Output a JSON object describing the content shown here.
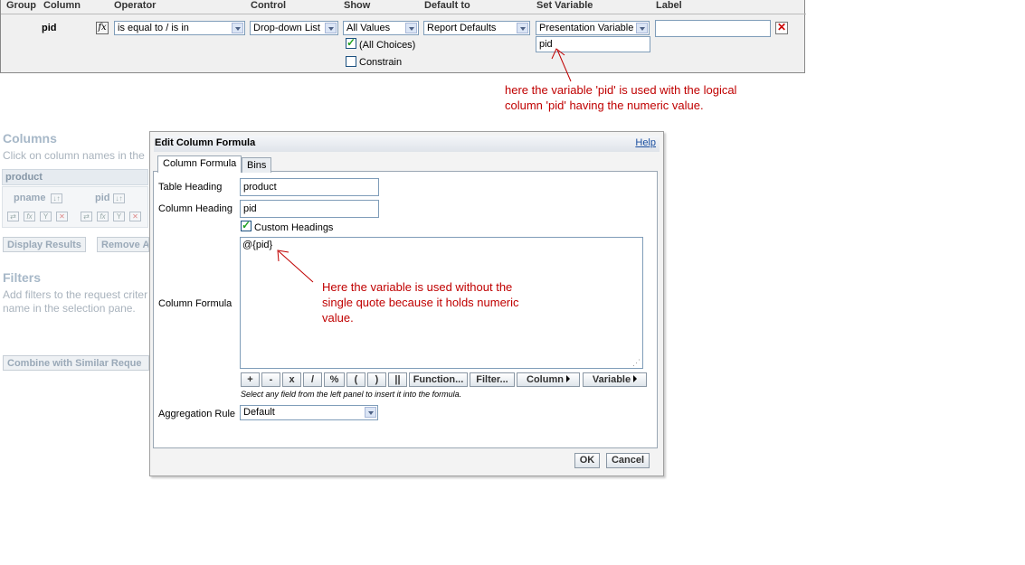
{
  "prompt_table": {
    "headers": {
      "group": "Group",
      "column": "Column",
      "operator": "Operator",
      "control": "Control",
      "show": "Show",
      "default_to": "Default to",
      "set_variable": "Set Variable",
      "label": "Label"
    },
    "row": {
      "column_name": "pid",
      "operator": "is equal to / is in",
      "control": "Drop-down List",
      "show": "All Values",
      "default_to": "Report Defaults",
      "set_variable": "Presentation Variable",
      "variable_name": "pid",
      "label_value": "",
      "all_choices_label": "(All Choices)",
      "constrain_label": "Constrain"
    }
  },
  "annotations": {
    "top_line1": "here the variable 'pid' is used with the logical",
    "top_line2": "column 'pid' having the numeric value.",
    "mid_line1": "Here the variable is used without the",
    "mid_line2": "single quote because it holds numeric",
    "mid_line3": "value."
  },
  "background": {
    "columns_heading": "Columns",
    "columns_hint": "Click on column names in the",
    "table_name": "product",
    "col1": "pname",
    "col2": "pid",
    "display_results": "Display Results",
    "remove_all": "Remove A",
    "filters_heading": "Filters",
    "filters_hint1": "Add filters to the request criter",
    "filters_hint2": "name in the selection pane.",
    "combine": "Combine with Similar Reque"
  },
  "dialog": {
    "title": "Edit Column Formula",
    "help": "Help",
    "tabs": [
      "Column Formula",
      "Bins"
    ],
    "table_heading_label": "Table Heading",
    "table_heading_value": "product",
    "column_heading_label": "Column Heading",
    "column_heading_value": "pid",
    "custom_headings_label": "Custom Headings",
    "column_formula_label": "Column Formula",
    "formula_value": "@{pid}",
    "formula_buttons": [
      "+",
      "-",
      "x",
      "/",
      "%",
      "(",
      ")",
      "||",
      "Function...",
      "Filter..."
    ],
    "column_menu": "Column",
    "variable_menu": "Variable",
    "hint": "Select any field from the left panel to insert it into the formula.",
    "aggregation_label": "Aggregation Rule",
    "aggregation_value": "Default",
    "ok": "OK",
    "cancel": "Cancel"
  },
  "colors": {
    "annotation": "#c00000",
    "check": "#21a121",
    "delete": "#cc0000"
  }
}
